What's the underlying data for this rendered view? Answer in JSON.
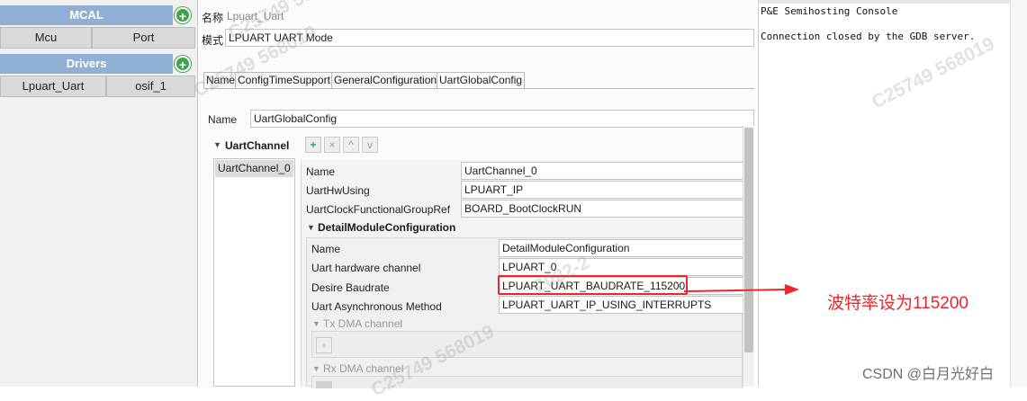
{
  "left_panel": {
    "mcal": {
      "title": "MCAL",
      "add_label": "+",
      "modules": [
        "Mcu",
        "Port"
      ]
    },
    "drivers": {
      "title": "Drivers",
      "add_label": "+",
      "modules": [
        "Lpuart_Uart",
        "osif_1"
      ]
    }
  },
  "editor": {
    "header_name_label": "名称",
    "header_name_value": "Lpuart_Uart",
    "mode_label": "模式",
    "mode_value": "LPUART UART Mode",
    "tabs": [
      "Name",
      "ConfigTimeSupport",
      "GeneralConfiguration",
      "UartGlobalConfig"
    ],
    "name_label": "Name",
    "name_value": "UartGlobalConfig",
    "channel_section": "UartChannel",
    "toolbar": {
      "add": "+",
      "remove": "×",
      "up": "^",
      "down": "v"
    },
    "channel_list": [
      "UartChannel_0"
    ],
    "channel_fields": [
      {
        "label": "Name",
        "value": "UartChannel_0"
      },
      {
        "label": "UartHwUsing",
        "value": "LPUART_IP"
      },
      {
        "label": "UartClockFunctionalGroupRef",
        "value": "BOARD_BootClockRUN"
      }
    ],
    "detail_section": "DetailModuleConfiguration",
    "detail_fields": [
      {
        "label": "Name",
        "value": "DetailModuleConfiguration"
      },
      {
        "label": "Uart hardware channel",
        "value": "LPUART_0"
      },
      {
        "label": "Desire Baudrate",
        "value": "LPUART_UART_BAUDRATE_115200"
      },
      {
        "label": "Uart Asynchronous Method",
        "value": "LPUART_UART_IP_USING_INTERRUPTS"
      }
    ],
    "tx_dma": "Tx DMA channel",
    "rx_dma": "Rx DMA channel",
    "dma_add": "+"
  },
  "console": {
    "title": "P&E Semihosting Console",
    "message": "Connection closed by the GDB server."
  },
  "annotation": {
    "text": "波特率设为115200",
    "color": "#e8282b"
  },
  "watermark": {
    "csdn": "CSDN @白月光好白",
    "ids": [
      "C25749 568019",
      "C25749 568019",
      "C25749 568019",
      "2022-2",
      "C25749 568019"
    ]
  }
}
